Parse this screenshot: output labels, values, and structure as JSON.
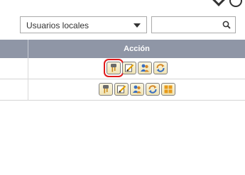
{
  "filter": {
    "user_scope_value": "Usuarios locales"
  },
  "search": {
    "placeholder": ""
  },
  "table": {
    "action_header": "Acción"
  },
  "rows": [
    {
      "actions": [
        "key-icon",
        "edit-icon",
        "users-icon",
        "refresh-icon"
      ],
      "selected_action": "key-icon"
    },
    {
      "actions": [
        "key-icon",
        "edit-icon",
        "users-icon",
        "refresh-icon",
        "grid-icon"
      ]
    }
  ],
  "colors": {
    "header_bg": "#8f96a6",
    "highlight": "#e01b1b"
  }
}
